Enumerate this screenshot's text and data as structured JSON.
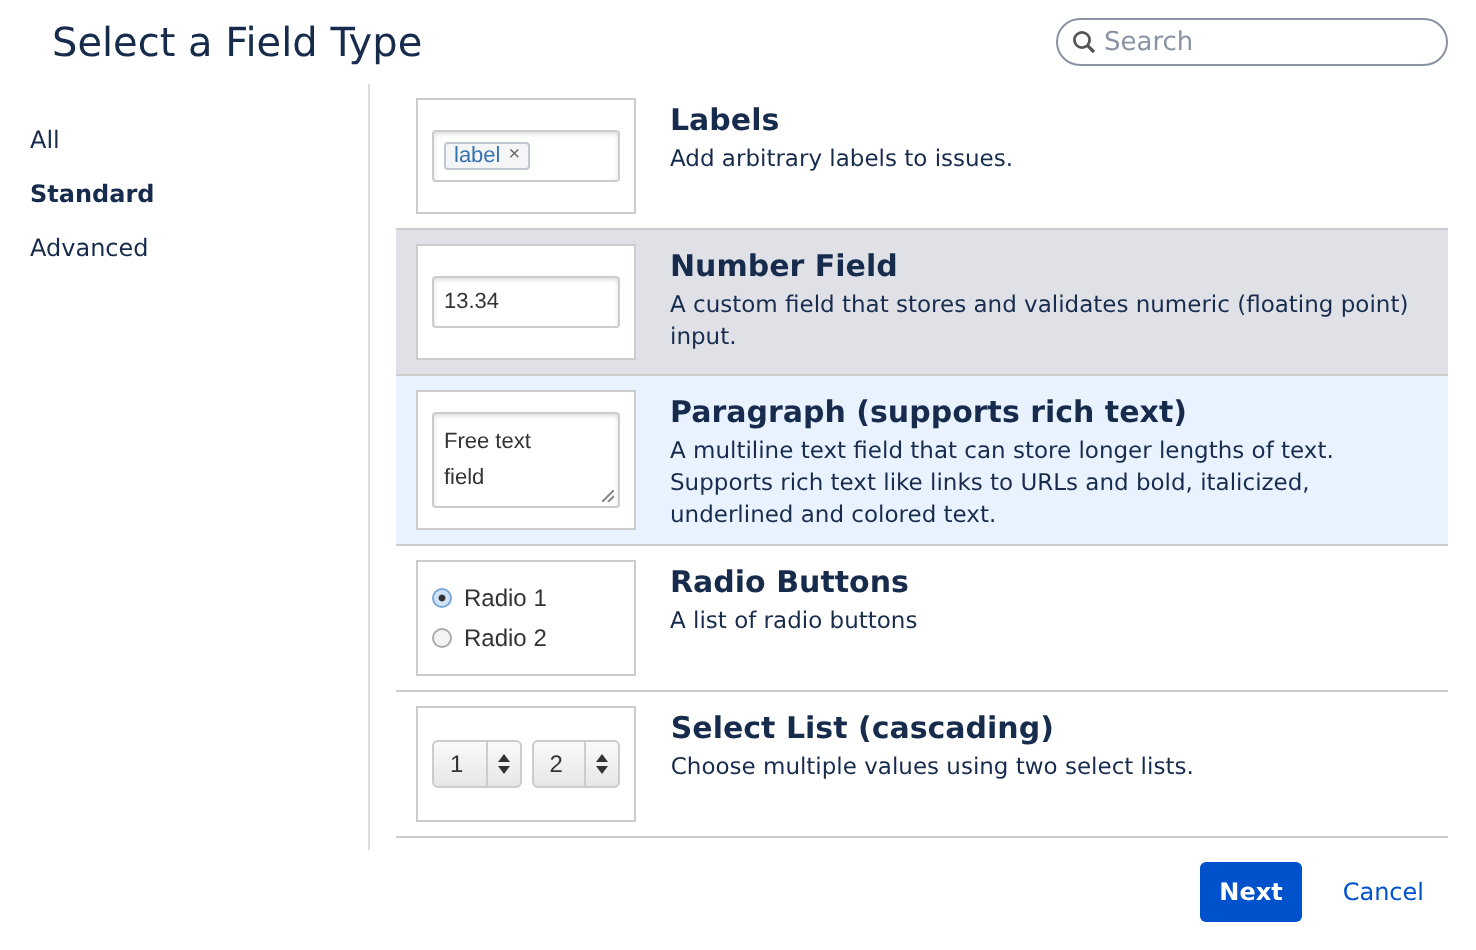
{
  "dialog": {
    "title": "Select a Field Type"
  },
  "search": {
    "placeholder": "Search"
  },
  "sidebar": {
    "items": [
      {
        "label": "All",
        "selected": false
      },
      {
        "label": "Standard",
        "selected": true
      },
      {
        "label": "Advanced",
        "selected": false
      }
    ]
  },
  "field_types": [
    {
      "kind": "labels",
      "name": "Labels",
      "description": "Add arbitrary labels to issues.",
      "selected": false,
      "hovered": false,
      "preview": {
        "tag": "label",
        "remove": "×"
      }
    },
    {
      "kind": "number",
      "name": "Number Field",
      "description": "A custom field that stores and validates numeric (floating point) input.",
      "selected": true,
      "hovered": false,
      "preview": {
        "value": "13.34"
      }
    },
    {
      "kind": "paragraph",
      "name": "Paragraph (supports rich text)",
      "description": "A multiline text field that can store longer lengths of text. Supports rich text like links to URLs and bold, italicized, underlined and colored text.",
      "selected": false,
      "hovered": true,
      "preview": {
        "lines": [
          "Free text",
          "field"
        ]
      }
    },
    {
      "kind": "radio",
      "name": "Radio Buttons",
      "description": "A list of radio buttons",
      "selected": false,
      "hovered": false,
      "preview": {
        "options": [
          {
            "label": "Radio 1",
            "selected": true
          },
          {
            "label": "Radio 2",
            "selected": false
          }
        ]
      }
    },
    {
      "kind": "select",
      "name": "Select List (cascading)",
      "description": "Choose multiple values using two select lists.",
      "selected": false,
      "hovered": false,
      "preview": {
        "values": [
          "1",
          "2"
        ]
      }
    }
  ],
  "buttons": {
    "primary": "Next",
    "link": "Cancel"
  }
}
